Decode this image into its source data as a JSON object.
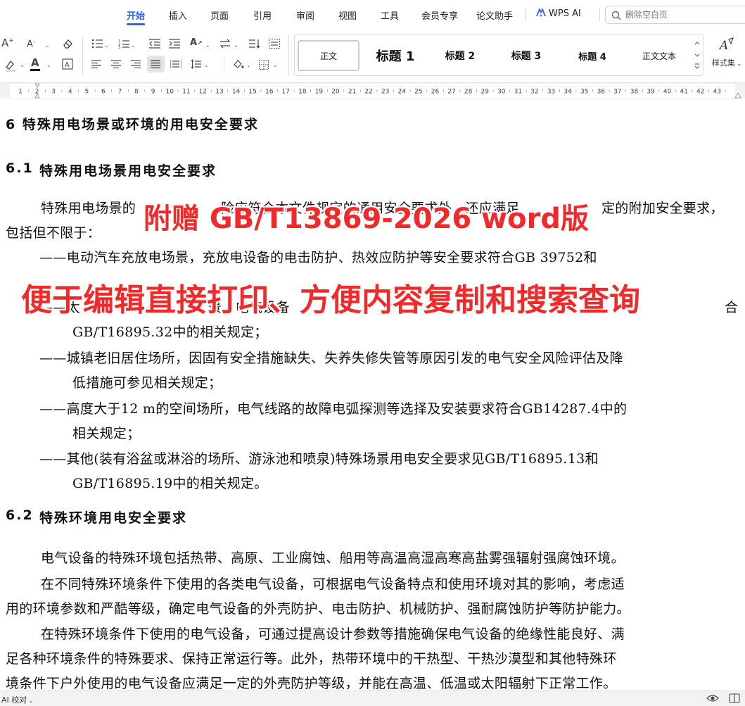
{
  "menu": {
    "tabs": [
      "开始",
      "插入",
      "页面",
      "引用",
      "审阅",
      "视图",
      "工具",
      "会员专享",
      "论文助手"
    ],
    "active_tab": "开始",
    "ai_label": "WPS AI",
    "search_placeholder": "删除空白页"
  },
  "ribbon": {
    "styles": [
      "正文",
      "标题 1",
      "标题 2",
      "标题 3",
      "标题 4",
      "正文文本"
    ],
    "styles_set_label": "样式集",
    "accent_color": "#2b64e6"
  },
  "ruler": {
    "numbers": [
      "1",
      "2",
      "3",
      "4",
      "5",
      "6",
      "7",
      "8",
      "9",
      "10",
      "11",
      "12",
      "13",
      "14",
      "15",
      "16",
      "17",
      "18",
      "19",
      "20",
      "21",
      "22",
      "23",
      "24",
      "25",
      "26",
      "27",
      "28",
      "29",
      "30",
      "31",
      "32",
      "33",
      "34",
      "35",
      "36",
      "37",
      "38",
      "39",
      "40",
      "41",
      "42",
      "43"
    ]
  },
  "document": {
    "h6": "6  特殊用电场景或环境的用电安全要求",
    "h61_num": "6.1",
    "h61_text": "特殊用电场景用电安全要求",
    "p1_l1": "特殊用电场景的",
    "p1_l1_mid": "险应符合本文件规定的通用安全要求外，还应满足",
    "p1_l1_end": "定的附加安全要求，",
    "p1_l2": "包括但不限于：",
    "b1_l1": "——电动汽车充放电场景，充放电设备的电击防护、热效应防护等安全要求符合GB 39752和",
    "b2_l1": "——太",
    "b2_l1_mid": "景，电气设备",
    "b2_l1_end": "合",
    "b2_l2": "GB/T16895.32中的相关规定；",
    "b3_l1": "——城镇老旧居住场所，因固有安全措施缺失、失养失修失管等原因引发的电气安全风险评估及降",
    "b3_l2": "低措施可参见相关规定；",
    "b4_l1": "——高度大于12 m的空间场所，电气线路的故障电弧探测等选择及安装要求符合GB14287.4中的",
    "b4_l2": "相关规定；",
    "b5_l1": "——其他(装有浴盆或淋浴的场所、游泳池和喷泉)特殊场景用电安全要求见GB/T16895.13和",
    "b5_l2": "GB/T16895.19中的相关规定。",
    "h62_num": "6.2",
    "h62_text": "特殊环境用电安全要求",
    "p2": "电气设备的特殊环境包括热带、高原、工业腐蚀、船用等高温高湿高寒高盐雾强辐射强腐蚀环境。",
    "p3_l1": "在不同特殊环境条件下使用的各类电气设备，可根据电气设备特点和使用环境对其的影响，考虑适",
    "p3_l2": "用的环境参数和严酷等级，确定电气设备的外壳防护、电击防护、机械防护、强耐腐蚀防护等防护能力。",
    "p4_l1": "在特殊环境条件下使用的电气设备，可通过提高设计参数等措施确保电气设备的绝缘性能良好、满",
    "p4_l2": "足各种环境条件的特殊要求、保持正常运行等。此外，热带环境中的干热型、干热沙漠型和其他特殊环",
    "p4_l3": "境条件下户外使用的电气设备应满足一定的外壳防护等级，并能在高温、低温或太阳辐射下正常工作。"
  },
  "overlay": {
    "line1": "附赠 GB/T13869-2026 word版",
    "line2": "便于编辑直接打印、方便内容复制和搜索查询",
    "color": "#f02a2a"
  },
  "status": {
    "proofread": "AI 校对"
  }
}
